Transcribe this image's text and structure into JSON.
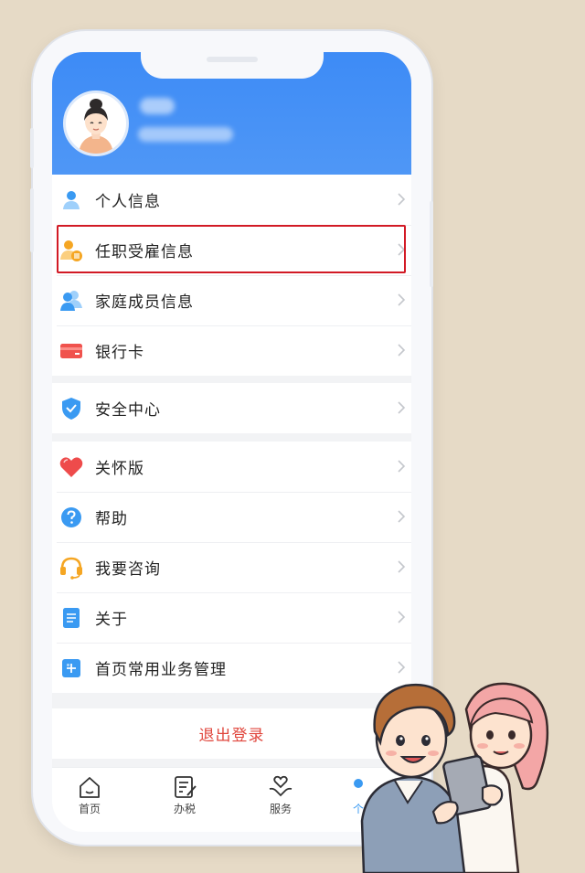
{
  "menu_group_1": [
    {
      "label": "个人信息",
      "icon": "person-icon"
    },
    {
      "label": "任职受雇信息",
      "icon": "employment-icon"
    },
    {
      "label": "家庭成员信息",
      "icon": "family-icon"
    },
    {
      "label": "银行卡",
      "icon": "bank-card-icon"
    }
  ],
  "menu_group_2": [
    {
      "label": "安全中心",
      "icon": "shield-icon"
    }
  ],
  "menu_group_3": [
    {
      "label": "关怀版",
      "icon": "heart-icon"
    },
    {
      "label": "帮助",
      "icon": "help-icon"
    },
    {
      "label": "我要咨询",
      "icon": "headset-icon"
    },
    {
      "label": "关于",
      "icon": "document-icon"
    },
    {
      "label": "首页常用业务管理",
      "icon": "plus-icon"
    }
  ],
  "logout_label": "退出登录",
  "tabs": [
    {
      "label": "首页",
      "icon": "home-icon"
    },
    {
      "label": "办税",
      "icon": "tax-form-icon"
    },
    {
      "label": "服务",
      "icon": "service-icon"
    },
    {
      "label": "个",
      "icon": "profile-icon"
    }
  ],
  "colors": {
    "header": "#3d8bf6",
    "highlight": "#d21a25",
    "logout": "#e0463c",
    "background": "#e6dac6"
  }
}
